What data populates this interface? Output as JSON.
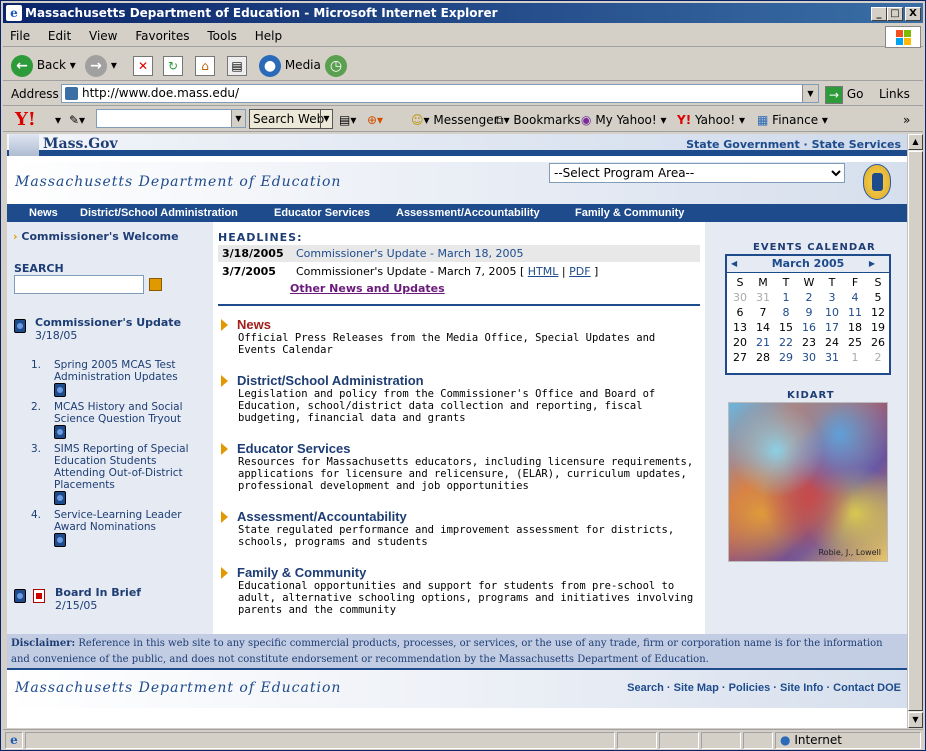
{
  "window": {
    "title": "Massachusetts Department of Education - Microsoft Internet Explorer",
    "min": "_",
    "max": "□",
    "close": "X"
  },
  "menu": [
    "File",
    "Edit",
    "View",
    "Favorites",
    "Tools",
    "Help"
  ],
  "toolbar": {
    "back": "Back",
    "media": "Media"
  },
  "address": {
    "label": "Address",
    "url": "http://www.doe.mass.edu/",
    "go": "Go",
    "links": "Links"
  },
  "yahoo": {
    "search_web": "Search Web",
    "messenger": "Messenger",
    "bookmarks": "Bookmarks",
    "my_yahoo": "My Yahoo!",
    "yahoo": "Yahoo!",
    "finance": "Finance"
  },
  "site": {
    "massgov": "Mass.Gov",
    "state_links": "State Government · State Services",
    "dept_title": "Massachusetts Department of Education",
    "program_select": "--Select Program Area--",
    "nav": [
      "News",
      "District/School Administration",
      "Educator Services",
      "Assessment/Accountability",
      "Family & Community"
    ]
  },
  "left": {
    "commissioner_welcome": "Commissioner's Welcome",
    "search_label": "SEARCH",
    "update_title": "Commissioner's Update",
    "update_date": "3/18/05",
    "items": [
      {
        "num": "1.",
        "text": "Spring 2005 MCAS Test Administration Updates"
      },
      {
        "num": "2.",
        "text": "MCAS History and Social Science Question Tryout"
      },
      {
        "num": "3.",
        "text": "SIMS Reporting of Special Education Students Attending Out-of-District Placements"
      },
      {
        "num": "4.",
        "text": "Service-Learning Leader Award Nominations"
      }
    ],
    "board_title": "Board In Brief",
    "board_date": "2/15/05"
  },
  "headlines": {
    "label": "HEADLINES:",
    "rows": [
      {
        "date": "3/18/2005",
        "text": "Commissioner's Update - March 18, 2005"
      },
      {
        "date": "3/7/2005",
        "text": "Commissioner's Update - March 7, 2005 [",
        "html": "HTML",
        "pipe": "|",
        "pdf": "PDF",
        "end": "]"
      }
    ],
    "other": "Other News and Updates"
  },
  "sections": [
    {
      "title": "News",
      "desc": "Official Press Releases from the Media Office, Special Updates and Events Calendar"
    },
    {
      "title": "District/School Administration",
      "desc": "Legislation and policy from the Commissioner's Office and Board of Education, school/district data collection and reporting, fiscal budgeting, financial data and grants"
    },
    {
      "title": "Educator Services",
      "desc": "Resources for Massachusetts educators, including licensure requirements, applications for licensure and relicensure, (ELAR), curriculum updates, professional development and job opportunities"
    },
    {
      "title": "Assessment/Accountability",
      "desc": "State regulated performance and improvement assessment for districts, schools, programs and students"
    },
    {
      "title": "Family & Community",
      "desc": "Educational opportunities and support for students from pre-school to adult, alternative schooling options, programs and initiatives involving parents and the community"
    }
  ],
  "calendar": {
    "label": "EVENTS CALENDAR",
    "month": "March 2005",
    "prev": "◀",
    "next": "▶",
    "days": [
      "S",
      "M",
      "T",
      "W",
      "T",
      "F",
      "S"
    ],
    "weeks": [
      [
        "30",
        "31",
        "1",
        "2",
        "3",
        "4",
        "5"
      ],
      [
        "6",
        "7",
        "8",
        "9",
        "10",
        "11",
        "12"
      ],
      [
        "13",
        "14",
        "15",
        "16",
        "17",
        "18",
        "19"
      ],
      [
        "20",
        "21",
        "22",
        "23",
        "24",
        "25",
        "26"
      ],
      [
        "27",
        "28",
        "29",
        "30",
        "31",
        "1",
        "2"
      ]
    ]
  },
  "kidart": {
    "label": "KIDART",
    "signature": "Robie, J., Lowell"
  },
  "disclaimer": {
    "label": "Disclaimer:",
    "text": "Reference in this web site to any specific commercial products, processes, or services, or the use of any trade, firm or corporation name is for the information and convenience of the public, and does not constitute endorsement or recommendation by the Massachusetts Department of Education."
  },
  "footer": {
    "title": "Massachusetts Department of Education",
    "links": "Search · Site Map · Policies · Site Info · Contact DOE"
  },
  "status": {
    "zone": "Internet"
  }
}
